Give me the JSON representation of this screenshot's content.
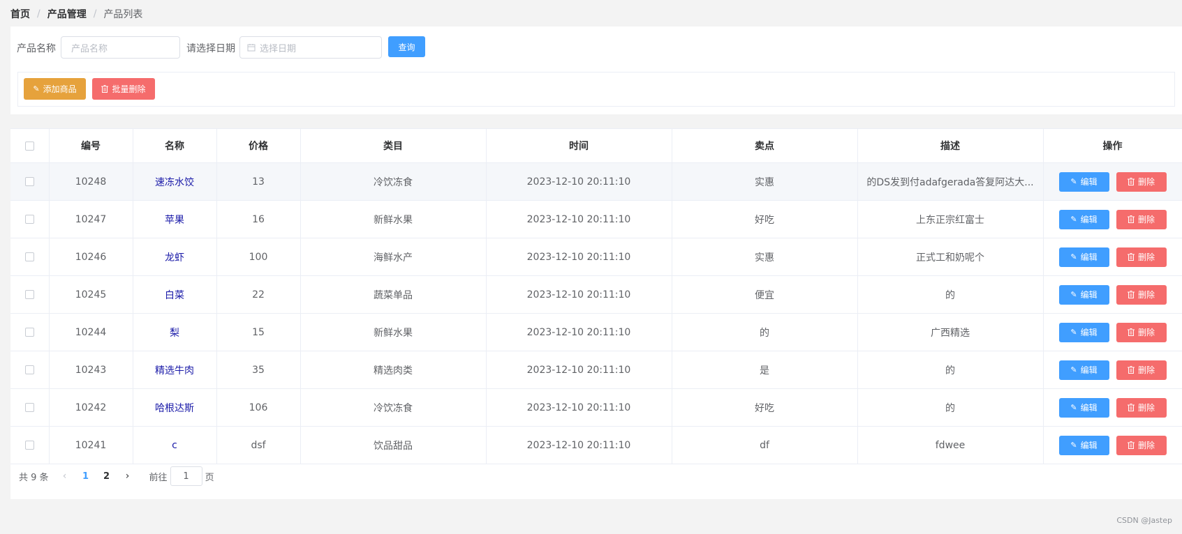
{
  "breadcrumb": {
    "home": "首页",
    "sep": "/",
    "level2": "产品管理",
    "current": "产品列表"
  },
  "search": {
    "name_label": "产品名称",
    "name_placeholder": "产品名称",
    "date_label": "请选择日期",
    "date_placeholder": "选择日期",
    "query_label": "查询"
  },
  "toolbar": {
    "add_label": "添加商品",
    "batch_delete_label": "批量删除"
  },
  "table": {
    "headers": [
      "编号",
      "名称",
      "价格",
      "类目",
      "时间",
      "卖点",
      "描述",
      "操作"
    ],
    "rows": [
      {
        "id": "10248",
        "name": "速冻水饺",
        "price": "13",
        "category": "冷饮冻食",
        "time": "2023-12-10 20:11:10",
        "selling_point": "实惠",
        "desc": "的DS发到付adafgerada答复阿达大..."
      },
      {
        "id": "10247",
        "name": "苹果",
        "price": "16",
        "category": "新鲜水果",
        "time": "2023-12-10 20:11:10",
        "selling_point": "好吃",
        "desc": "上东正宗红富士"
      },
      {
        "id": "10246",
        "name": "龙虾",
        "price": "100",
        "category": "海鲜水产",
        "time": "2023-12-10 20:11:10",
        "selling_point": "实惠",
        "desc": "正式工和奶呢个"
      },
      {
        "id": "10245",
        "name": "白菜",
        "price": "22",
        "category": "蔬菜单品",
        "time": "2023-12-10 20:11:10",
        "selling_point": "便宜",
        "desc": "的"
      },
      {
        "id": "10244",
        "name": "梨",
        "price": "15",
        "category": "新鲜水果",
        "time": "2023-12-10 20:11:10",
        "selling_point": "的",
        "desc": "广西精选"
      },
      {
        "id": "10243",
        "name": "精选牛肉",
        "price": "35",
        "category": "精选肉类",
        "time": "2023-12-10 20:11:10",
        "selling_point": "是",
        "desc": "的"
      },
      {
        "id": "10242",
        "name": "哈根达斯",
        "price": "106",
        "category": "冷饮冻食",
        "time": "2023-12-10 20:11:10",
        "selling_point": "好吃",
        "desc": "的"
      },
      {
        "id": "10241",
        "name": "c",
        "price": "dsf",
        "category": "饮品甜品",
        "time": "2023-12-10 20:11:10",
        "selling_point": "df",
        "desc": "fdwee"
      }
    ],
    "edit_label": "编辑",
    "delete_label": "删除"
  },
  "pagination": {
    "total_text": "共 9 条",
    "pages": [
      "1",
      "2"
    ],
    "current_page": "1",
    "goto_label": "前往",
    "goto_value": "1",
    "page_suffix": "页"
  },
  "watermark": "CSDN @Jastep",
  "colors": {
    "primary": "#409eff",
    "warning": "#e6a23c",
    "danger": "#f56c6c"
  },
  "icons": {
    "edit": "edit-icon",
    "delete": "trash-icon",
    "calendar": "calendar-icon",
    "prev": "chevron-left-icon",
    "next": "chevron-right-icon"
  }
}
